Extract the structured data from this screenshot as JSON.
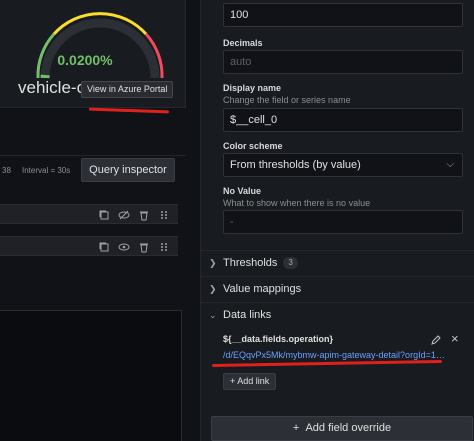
{
  "gauge": {
    "value": "0.0200%",
    "panel_title": "vehicle-co",
    "percent_fill": 0.0002
  },
  "tooltip": {
    "text": "View in Azure Portal"
  },
  "query_bar": {
    "rows_suffix": "38",
    "interval": "Interval = 30s",
    "inspector_label": "Query inspector"
  },
  "right": {
    "max_value": "100",
    "decimals_label": "Decimals",
    "decimals_placeholder": "auto",
    "display_name_label": "Display name",
    "display_name_desc": "Change the field or series name",
    "display_name_value": "$__cell_0",
    "color_scheme_label": "Color scheme",
    "color_scheme_value": "From thresholds (by value)",
    "no_value_label": "No Value",
    "no_value_desc": "What to show when there is no value",
    "no_value_placeholder": "-",
    "thresholds_label": "Thresholds",
    "thresholds_count": "3",
    "value_mappings_label": "Value mappings",
    "data_links_label": "Data links",
    "link_title": "${__data.fields.operation}",
    "link_url": "/d/EQqvPx5Mk/mybmw-apim-gateway-detail?orgId=1&f...",
    "add_link_label": "Add link",
    "add_override_label": "Add field override"
  },
  "colors": {
    "gauge_green": "#73bf69",
    "gauge_yellow": "#fade2a",
    "gauge_red": "#f2495c",
    "annotation_red": "#e0201c",
    "link_blue": "#6e9fff"
  }
}
